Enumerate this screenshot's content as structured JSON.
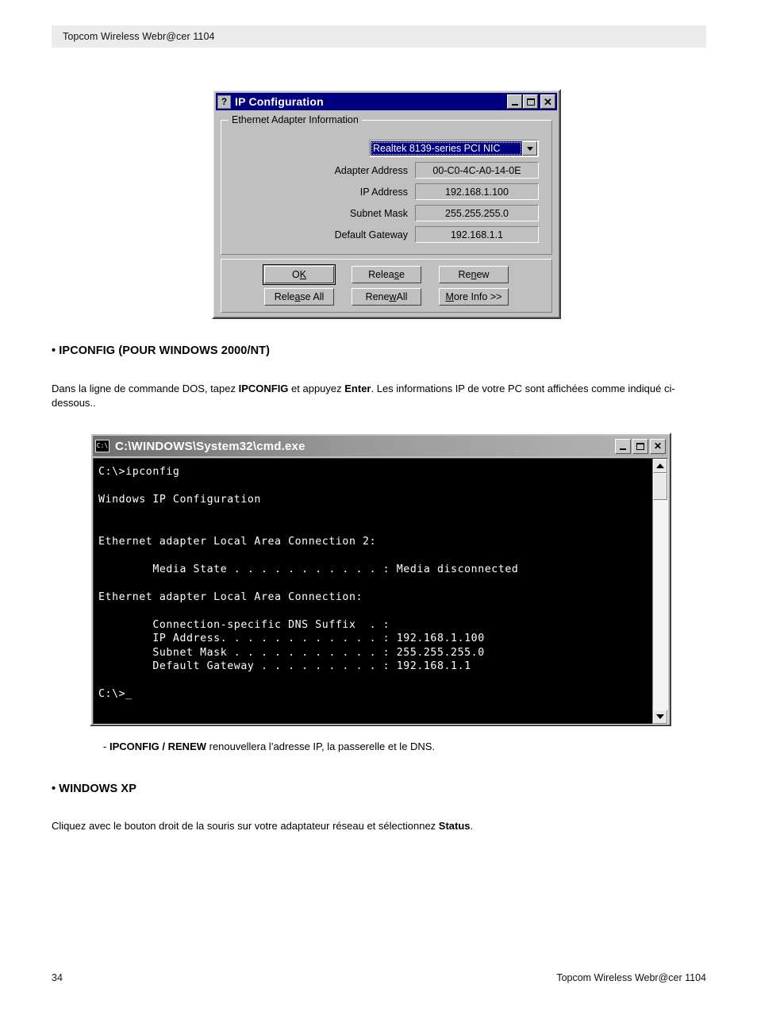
{
  "page_header": {
    "title": "Topcom Wireless Webr@cer 1104"
  },
  "ip_config_dialog": {
    "title": "IP Configuration",
    "icon": "help-question-icon",
    "window_buttons": {
      "minimize": "_",
      "maximize": "□",
      "close": "×"
    },
    "groupbox_title": "Ethernet  Adapter Information",
    "adapter_select": {
      "selected": "Realtek 8139-series PCI NIC"
    },
    "fields": [
      {
        "label": "Adapter Address",
        "value": "00-C0-4C-A0-14-0E"
      },
      {
        "label": "IP Address",
        "value": "192.168.1.100"
      },
      {
        "label": "Subnet Mask",
        "value": "255.255.255.0"
      },
      {
        "label": "Default Gateway",
        "value": "192.168.1.1"
      }
    ],
    "buttons": [
      {
        "label": "OK",
        "mnemonic_index": 1,
        "default": true
      },
      {
        "label": "Release",
        "mnemonic_index": 5,
        "default": false
      },
      {
        "label": "Renew",
        "mnemonic_index": 2,
        "default": false
      },
      {
        "label": "Release All",
        "mnemonic_index": 4,
        "default": false
      },
      {
        "label": "Renew All",
        "mnemonic_index": 4,
        "default": false
      },
      {
        "label": "More Info >>",
        "mnemonic_index": 0,
        "default": false
      }
    ]
  },
  "section_ipconfig": {
    "heading": "• IPCONFIG (POUR WINDOWS 2000/NT)",
    "paragraph_part1": "Dans la ligne de commande DOS, tapez ",
    "paragraph_bold1": "IPCONFIG",
    "paragraph_part2": " et appuyez ",
    "paragraph_bold2": "Enter",
    "paragraph_part3": ".  Les informations IP de votre PC sont affichées comme indiqué ci-dessous.."
  },
  "cmd_window": {
    "title": "C:\\WINDOWS\\System32\\cmd.exe",
    "icon_label": "C:\\",
    "window_buttons": {
      "minimize": "_",
      "maximize": "□",
      "close": "✕"
    },
    "console_text": "C:\\>ipconfig\n\nWindows IP Configuration\n\n\nEthernet adapter Local Area Connection 2:\n\n        Media State . . . . . . . . . . . : Media disconnected\n\nEthernet adapter Local Area Connection:\n\n        Connection-specific DNS Suffix  . :\n        IP Address. . . . . . . . . . . . : 192.168.1.100\n        Subnet Mask . . . . . . . . . . . : 255.255.255.0\n        Default Gateway . . . . . . . . . : 192.168.1.1\n\nC:\\>_",
    "scrollbar": {
      "up_arrow": "▲",
      "down_arrow": "▼"
    }
  },
  "note_renew": {
    "prefix": "- ",
    "bold": "IPCONFIG / RENEW",
    "rest": " renouvellera l’adresse IP, la passerelle et le DNS."
  },
  "section_winxp": {
    "heading": "• WINDOWS XP",
    "paragraph_part1": "Cliquez avec le bouton droit de la souris sur votre adaptateur réseau et sélectionnez ",
    "paragraph_bold1": "Status",
    "paragraph_part2": "."
  },
  "footer": {
    "page_number": "34",
    "document_title": "Topcom Wireless Webr@cer 1104"
  },
  "colors": {
    "header_band": "#ebebeb",
    "dialog_face": "#c0c0c0",
    "titlebar_active": "#000080",
    "console_bg": "#000000",
    "console_fg": "#ffffff"
  }
}
